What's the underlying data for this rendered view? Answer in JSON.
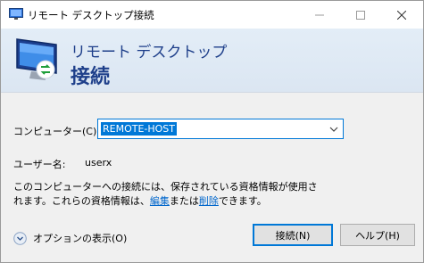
{
  "window": {
    "title": "リモート デスクトップ接続",
    "icons": {
      "app": "remote-desktop-icon",
      "minimize": "minimize-icon",
      "maximize": "maximize-icon",
      "close": "close-icon"
    }
  },
  "banner": {
    "line1": "リモート デスクトップ",
    "line2": "接続",
    "icon": "monitor-remote-icon"
  },
  "form": {
    "computer_label": "コンピューター(C):",
    "computer_value": "REMOTE-HOST",
    "user_label": "ユーザー名:",
    "user_value": "userx"
  },
  "info": {
    "text_part1": "このコンピューターへの接続には、保存されている資格情報が使用されます。これらの資格情報は、",
    "edit_link": "編集",
    "text_part2": "または",
    "delete_link": "削除",
    "text_part3": "できます。"
  },
  "options_label": "オプションの表示(O)",
  "buttons": {
    "connect": "接続(N)",
    "help": "ヘルプ(H)"
  },
  "colors": {
    "accent": "#0078d7",
    "banner_text": "#1e3f8a",
    "link": "#0066cc"
  }
}
